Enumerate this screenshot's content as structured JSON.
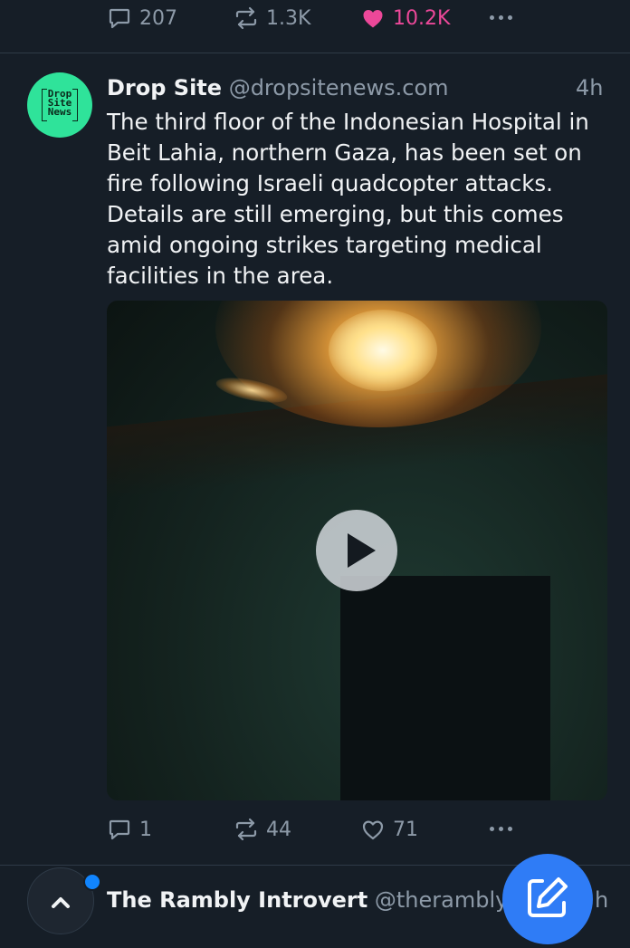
{
  "top_post": {
    "replies": "207",
    "reposts": "1.3K",
    "likes": "10.2K"
  },
  "post": {
    "author_name": "Drop Site",
    "author_handle": "@dropsitenews.com",
    "avatar_text": "Drop\nSite\nNews",
    "time": "4h",
    "text": "The third floor of the Indonesian Hospital in Beit Lahia, northern Gaza, has been set on fire following Israeli quadcopter attacks. Details are still emerging, but this comes amid ongoing strikes targeting medical facilities in the area.",
    "replies": "1",
    "reposts": "44",
    "likes": "71"
  },
  "next_post": {
    "author_name": "The Rambly Introvert",
    "author_handle": "@theramblyin",
    "time_partial": "h"
  },
  "colors": {
    "background": "#161e27",
    "like_active": "#ec4899",
    "muted": "#8d9aa8",
    "fab": "#2f7cf6",
    "avatar_bg": "#2fe39a"
  }
}
